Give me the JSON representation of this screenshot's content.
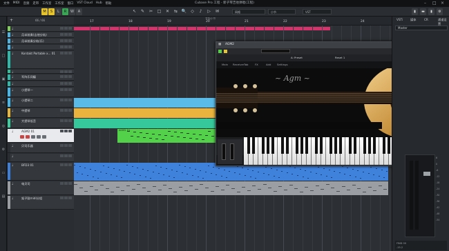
{
  "app": {
    "title": "Cubase Pro 工程 - 新子琴吉他弹唱(工程)",
    "menu": [
      "文件",
      "MIDI",
      "音频",
      "走带",
      "工作室",
      "工作室",
      "窗口",
      "VST Cloud",
      "Hub",
      "帮助"
    ]
  },
  "toolbar": {
    "buttons": [
      {
        "label": "M",
        "color": "#e6c22b"
      },
      {
        "label": "S",
        "color": "#e6c22b"
      },
      {
        "label": "L",
        "color": "#3a3d41"
      },
      {
        "label": "R",
        "color": "#3aa655"
      },
      {
        "label": "W",
        "color": "#3a3d41"
      },
      {
        "label": "A",
        "color": "#3a3d41"
      }
    ],
    "tools": [
      "↖",
      "✎",
      "✂",
      "□",
      "✕",
      "⇆",
      "🔍",
      "◇",
      "♪",
      "▷",
      "✉"
    ],
    "snap_value": "网格",
    "quantize_value": "1/64",
    "quantize_preset": "小节",
    "unit_value": "VST"
  },
  "ruler": {
    "bars": [
      "17",
      "18",
      "19",
      "20",
      "21",
      "22",
      "23",
      "24"
    ],
    "position_label": "节拍/小节"
  },
  "tracklist": {
    "counter": "66 / 66",
    "tracks": [
      {
        "name": "",
        "color": "#7fcf5a",
        "height": 8
      },
      {
        "name": "月半前奏(吉他分轨)",
        "color": "#4fb3e0",
        "height": 8
      },
      {
        "name": "月半前奏分轨(乐)",
        "color": "#4fb3e0",
        "height": 8
      },
      {
        "name": "",
        "color": "#4fb3e0",
        "height": 8
      },
      {
        "name": "Kontakt Portable x... 01",
        "color": "#2fb8a8",
        "height": 26
      },
      {
        "name": "",
        "color": "#30c09a",
        "height": 6
      },
      {
        "name": "军阵乐同编",
        "color": "#2fb8a8",
        "height": 9
      },
      {
        "name": "",
        "color": "#2fb8a8",
        "height": 8
      },
      {
        "name": "小提琴一",
        "color": "#45b7e8",
        "height": 14
      },
      {
        "name": "小提琴二",
        "color": "#45b7e8",
        "height": 14
      },
      {
        "name": "中提琴",
        "color": "#e6b53a",
        "height": 14
      },
      {
        "name": "大提琴低音",
        "color": "#3ccc9e",
        "height": 14
      },
      {
        "name": "AGM2 01",
        "color": "#e8eaed",
        "height": 20,
        "selected": true
      },
      {
        "name": "贝司乐器",
        "color": "#2a2d31",
        "height": 14
      },
      {
        "name": "",
        "color": "#2a2d31",
        "height": 12
      },
      {
        "name": "BFD3 01",
        "color": "#3e7fd8",
        "height": 26
      },
      {
        "name": "电贝司",
        "color": "#9a9da1",
        "height": 20
      },
      {
        "name": "架子鼓midi分组",
        "color": "#9a9da1",
        "height": 20
      }
    ]
  },
  "arrange": {
    "locator_color": "#d6336c",
    "selected_part_label": "AGM2 01",
    "part_colors": {
      "strings1": "#5bbbe8",
      "strings2": "#e9b33d",
      "strings3": "#36c79a",
      "agm": "#53d14a",
      "drums": "#3f82dc",
      "bass": "#9b9ea2"
    }
  },
  "plugin": {
    "window_title": "AGM2",
    "nav": [
      "Main",
      "Receiver",
      "Tab",
      "FX",
      "Add",
      "Settings"
    ],
    "preset_label": "A: Preset",
    "preset_name": "Reset 1"
  },
  "rightpanel": {
    "tabs": [
      "VSTi",
      "媒体",
      "CR",
      "通道设置"
    ],
    "preset_value": "Master",
    "meter_scale": [
      "6",
      "0",
      "-6",
      "-12",
      "-18",
      "-24",
      "-30",
      "-36",
      "-42",
      "-48",
      "-54"
    ],
    "bottom_left": "FIND 00",
    "bottom_value": "-15.2"
  }
}
